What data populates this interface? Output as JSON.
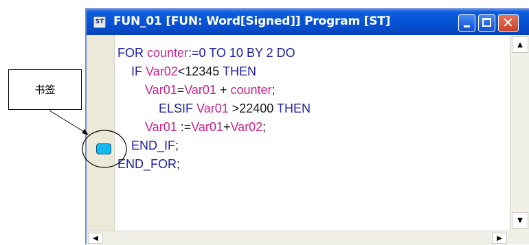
{
  "window": {
    "title": "FUN_01 [FUN: Word[Signed]] Program [ST]",
    "icon_label": "ST",
    "controls": [
      "minimize",
      "maximize",
      "close"
    ]
  },
  "annotation": {
    "label": "书签",
    "target": "bookmark"
  },
  "code_lines": [
    [
      {
        "t": "kw",
        "s": "FOR "
      },
      {
        "t": "var",
        "s": "counter"
      },
      {
        "t": "kw",
        "s": ":=0 TO 10 BY 2 DO"
      }
    ],
    [
      {
        "t": "kw",
        "s": "    IF "
      },
      {
        "t": "var",
        "s": "Var02"
      },
      {
        "t": "txt",
        "s": "<12345 "
      },
      {
        "t": "kw",
        "s": "THEN"
      }
    ],
    [
      {
        "t": "txt",
        "s": "        "
      },
      {
        "t": "var",
        "s": "Var01"
      },
      {
        "t": "txt",
        "s": "="
      },
      {
        "t": "var",
        "s": "Var01"
      },
      {
        "t": "txt",
        "s": " + "
      },
      {
        "t": "var",
        "s": "counter"
      },
      {
        "t": "txt",
        "s": ";"
      }
    ],
    [
      {
        "t": "kw",
        "s": "            ELSIF "
      },
      {
        "t": "var",
        "s": "Var01"
      },
      {
        "t": "txt",
        "s": " >22400 "
      },
      {
        "t": "kw",
        "s": "THEN"
      }
    ],
    [
      {
        "t": "txt",
        "s": "        "
      },
      {
        "t": "var",
        "s": "Var01"
      },
      {
        "t": "txt",
        "s": " :="
      },
      {
        "t": "var",
        "s": "Var01"
      },
      {
        "t": "txt",
        "s": "+"
      },
      {
        "t": "var",
        "s": "Var02"
      },
      {
        "t": "txt",
        "s": ";"
      }
    ],
    [
      {
        "t": "kw",
        "s": "    END_IF"
      },
      {
        "t": "txt",
        "s": ";"
      }
    ],
    [
      {
        "t": "kw",
        "s": "END_FOR"
      },
      {
        "t": "txt",
        "s": ";"
      }
    ]
  ],
  "colors": {
    "keyword": "#2020a0",
    "variable": "#c8228a",
    "text": "#1a1a1a",
    "bookmark": "#14b8f0",
    "titlebar": "#0650d2"
  },
  "icons": {
    "scroll_up": "▲",
    "scroll_down": "▼",
    "scroll_left": "◀",
    "scroll_right": "▶",
    "close": "✕"
  }
}
